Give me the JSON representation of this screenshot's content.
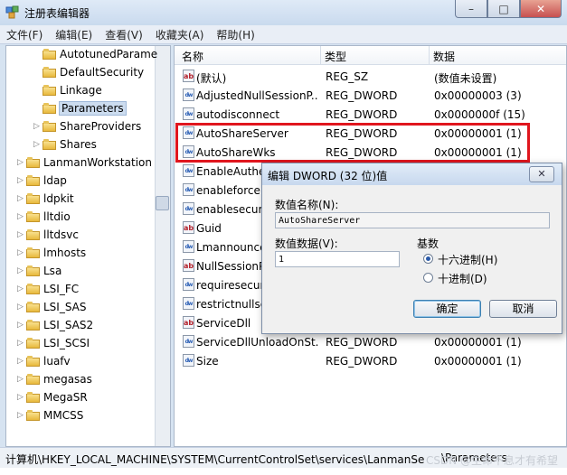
{
  "window": {
    "title": "注册表编辑器",
    "controls": {
      "minimize": "–",
      "maximize": "□",
      "close": "✕"
    }
  },
  "menu": [
    "文件(F)",
    "编辑(E)",
    "查看(V)",
    "收藏夹(A)",
    "帮助(H)"
  ],
  "tree": {
    "items": [
      {
        "label": "AutotunedParame",
        "indent": 2,
        "arrow": ""
      },
      {
        "label": "DefaultSecurity",
        "indent": 2,
        "arrow": ""
      },
      {
        "label": "Linkage",
        "indent": 2,
        "arrow": ""
      },
      {
        "label": "Parameters",
        "indent": 2,
        "arrow": "",
        "selected": true
      },
      {
        "label": "ShareProviders",
        "indent": 2,
        "arrow": "▷"
      },
      {
        "label": "Shares",
        "indent": 2,
        "arrow": "▷"
      },
      {
        "label": "LanmanWorkstation",
        "indent": 1,
        "arrow": "▷"
      },
      {
        "label": "ldap",
        "indent": 1,
        "arrow": "▷"
      },
      {
        "label": "ldpkit",
        "indent": 1,
        "arrow": "▷"
      },
      {
        "label": "lltdio",
        "indent": 1,
        "arrow": "▷"
      },
      {
        "label": "lltdsvc",
        "indent": 1,
        "arrow": "▷"
      },
      {
        "label": "lmhosts",
        "indent": 1,
        "arrow": "▷"
      },
      {
        "label": "Lsa",
        "indent": 1,
        "arrow": "▷"
      },
      {
        "label": "LSI_FC",
        "indent": 1,
        "arrow": "▷"
      },
      {
        "label": "LSI_SAS",
        "indent": 1,
        "arrow": "▷"
      },
      {
        "label": "LSI_SAS2",
        "indent": 1,
        "arrow": "▷"
      },
      {
        "label": "LSI_SCSI",
        "indent": 1,
        "arrow": "▷"
      },
      {
        "label": "luafv",
        "indent": 1,
        "arrow": "▷"
      },
      {
        "label": "megasas",
        "indent": 1,
        "arrow": "▷"
      },
      {
        "label": "MegaSR",
        "indent": 1,
        "arrow": "▷"
      },
      {
        "label": "MMCSS",
        "indent": 1,
        "arrow": "▷"
      }
    ]
  },
  "list": {
    "headers": {
      "name": "名称",
      "type": "类型",
      "data": "数据"
    },
    "rows": [
      {
        "icon": "ab",
        "name": "(默认)",
        "type": "REG_SZ",
        "data": "(数值未设置)"
      },
      {
        "icon": "dw",
        "name": "AdjustedNullSessionP...",
        "type": "REG_DWORD",
        "data": "0x00000003 (3)"
      },
      {
        "icon": "dw",
        "name": "autodisconnect",
        "type": "REG_DWORD",
        "data": "0x0000000f (15)"
      },
      {
        "icon": "dw",
        "name": "AutoShareServer",
        "type": "REG_DWORD",
        "data": "0x00000001 (1)"
      },
      {
        "icon": "dw",
        "name": "AutoShareWks",
        "type": "REG_DWORD",
        "data": "0x00000001 (1)"
      },
      {
        "icon": "dw",
        "name": "EnableAuthe",
        "type": "",
        "data": ""
      },
      {
        "icon": "dw",
        "name": "enableforce",
        "type": "",
        "data": ""
      },
      {
        "icon": "dw",
        "name": "enablesecur",
        "type": "",
        "data": ""
      },
      {
        "icon": "ab",
        "name": "Guid",
        "type": "",
        "data": ""
      },
      {
        "icon": "dw",
        "name": "Lmannounce",
        "type": "",
        "data": ""
      },
      {
        "icon": "ab",
        "name": "NullSessionP",
        "type": "",
        "data": ""
      },
      {
        "icon": "dw",
        "name": "requiresecur",
        "type": "",
        "data": ""
      },
      {
        "icon": "dw",
        "name": "restrictnullse",
        "type": "",
        "data": ""
      },
      {
        "icon": "ab",
        "name": "ServiceDll",
        "type": "",
        "data": ""
      },
      {
        "icon": "dw",
        "name": "ServiceDllUnloadOnSt...",
        "type": "REG_DWORD",
        "data": "0x00000001 (1)"
      },
      {
        "icon": "dw",
        "name": "Size",
        "type": "REG_DWORD",
        "data": "0x00000001 (1)"
      }
    ]
  },
  "status_path": "计算机\\HKEY_LOCAL_MACHINE\\SYSTEM\\CurrentControlSet\\services\\LanmanSe",
  "status_path_tail": "\\Parameters",
  "watermark": "CSDN @生命不息才有希望",
  "dialog": {
    "title": "编辑 DWORD (32 位)值",
    "value_name_label": "数值名称(N):",
    "value_name": "AutoShareServer",
    "value_data_label": "数值数据(V):",
    "value_data": "1",
    "base_label": "基数",
    "hex_label": "十六进制(H)",
    "dec_label": "十进制(D)",
    "base_selected": "hex",
    "ok": "确定",
    "cancel": "取消",
    "close": "✕"
  }
}
